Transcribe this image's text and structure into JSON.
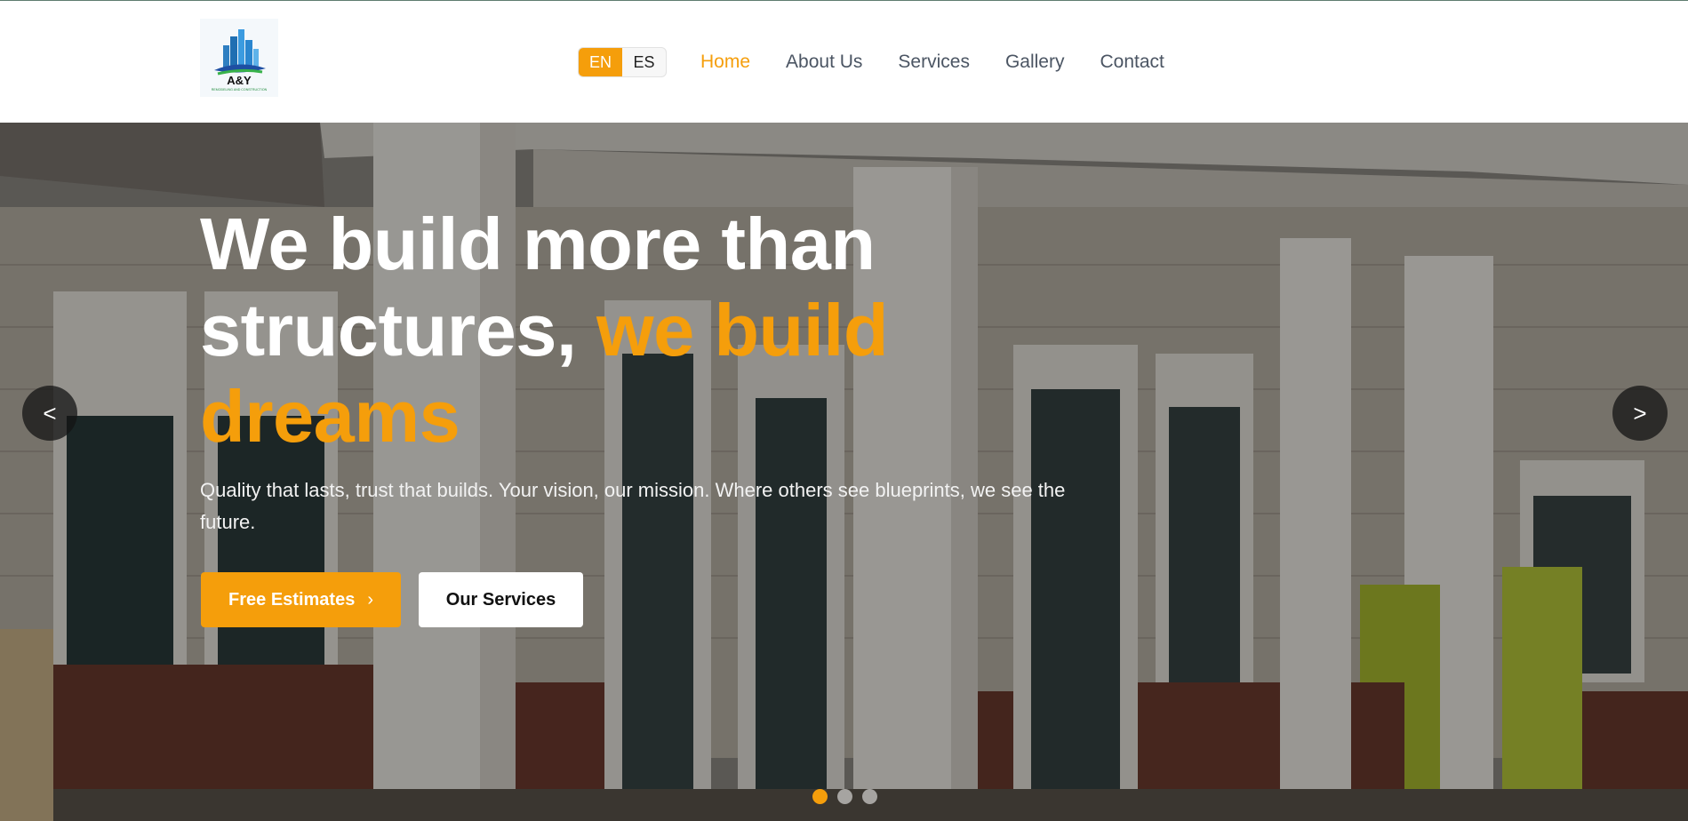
{
  "brand": {
    "logo_text": "A&Y",
    "logo_subtext": "REMODELING AND CONSTRUCTION"
  },
  "language": {
    "options": [
      "EN",
      "ES"
    ],
    "selected": "EN"
  },
  "nav": {
    "items": [
      "Home",
      "About Us",
      "Services",
      "Gallery",
      "Contact"
    ],
    "active": "Home"
  },
  "hero": {
    "headline_line1": "We build more than",
    "headline_line2_white": "structures,",
    "headline_line2_accent": "we build",
    "headline_line3_accent": "dreams",
    "subtitle": "Quality that lasts, trust that builds. Your vision, our mission. Where others see blueprints, we see the future.",
    "primary_button": "Free Estimates",
    "primary_button_icon": "›",
    "secondary_button": "Our Services",
    "prev_arrow": "<",
    "next_arrow": ">",
    "slide_count": 3,
    "active_slide": 1
  },
  "colors": {
    "accent": "#f59e0b",
    "nav_text": "#4b5563",
    "header_bg": "#ffffff"
  }
}
